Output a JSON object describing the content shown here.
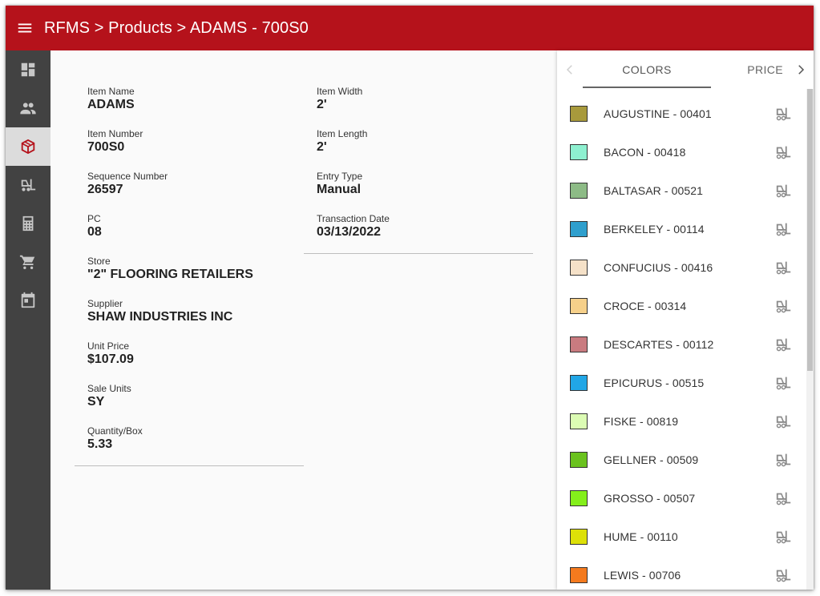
{
  "app": {
    "title": "RFMS > Products > ADAMS - 700S0"
  },
  "sidebar": {
    "items": [
      {
        "icon": "dashboard-icon",
        "active": false
      },
      {
        "icon": "people-icon",
        "active": false
      },
      {
        "icon": "package-icon",
        "active": true
      },
      {
        "icon": "forklift-icon",
        "active": false
      },
      {
        "icon": "calculator-icon",
        "active": false
      },
      {
        "icon": "cart-icon",
        "active": false
      },
      {
        "icon": "calendar-icon",
        "active": false
      }
    ]
  },
  "details": {
    "left": [
      {
        "label": "Item Name",
        "value": "ADAMS"
      },
      {
        "label": "Item Number",
        "value": "700S0"
      },
      {
        "label": "Sequence Number",
        "value": "26597"
      },
      {
        "label": "PC",
        "value": "08"
      },
      {
        "label": "Store",
        "value": "\"2\" FLOORING RETAILERS"
      },
      {
        "label": "Supplier",
        "value": "SHAW INDUSTRIES INC"
      },
      {
        "label": "Unit Price",
        "value": "$107.09"
      },
      {
        "label": "Sale Units",
        "value": "SY"
      },
      {
        "label": "Quantity/Box",
        "value": "5.33"
      }
    ],
    "right": [
      {
        "label": "Item Width",
        "value": "2'"
      },
      {
        "label": "Item Length",
        "value": "2'"
      },
      {
        "label": "Entry Type",
        "value": "Manual"
      },
      {
        "label": "Transaction Date",
        "value": "03/13/2022"
      }
    ]
  },
  "panel": {
    "tabs": [
      {
        "label": "COLORS",
        "active": true
      },
      {
        "label": "PRICE",
        "active": false
      }
    ],
    "colors": [
      {
        "name": "AUGUSTINE - 00401",
        "swatch": "#a89a3c"
      },
      {
        "name": "BACON - 00418",
        "swatch": "#8ef0d0"
      },
      {
        "name": "BALTASAR - 00521",
        "swatch": "#8dbb86"
      },
      {
        "name": "BERKELEY - 00114",
        "swatch": "#2f9fcd"
      },
      {
        "name": "CONFUCIUS - 00416",
        "swatch": "#f5e1c8"
      },
      {
        "name": "CROCE - 00314",
        "swatch": "#f6d08a"
      },
      {
        "name": "DESCARTES - 00112",
        "swatch": "#c97b80"
      },
      {
        "name": "EPICURUS - 00515",
        "swatch": "#21a6e6"
      },
      {
        "name": "FISKE - 00819",
        "swatch": "#dcfcb4"
      },
      {
        "name": "GELLNER - 00509",
        "swatch": "#6ac21e"
      },
      {
        "name": "GROSSO - 00507",
        "swatch": "#84ef1b"
      },
      {
        "name": "HUME - 00110",
        "swatch": "#dde008"
      },
      {
        "name": "LEWIS - 00706",
        "swatch": "#f47a1e"
      }
    ]
  },
  "colors": {
    "brand": "#b5121b",
    "sidebar": "#424242"
  }
}
